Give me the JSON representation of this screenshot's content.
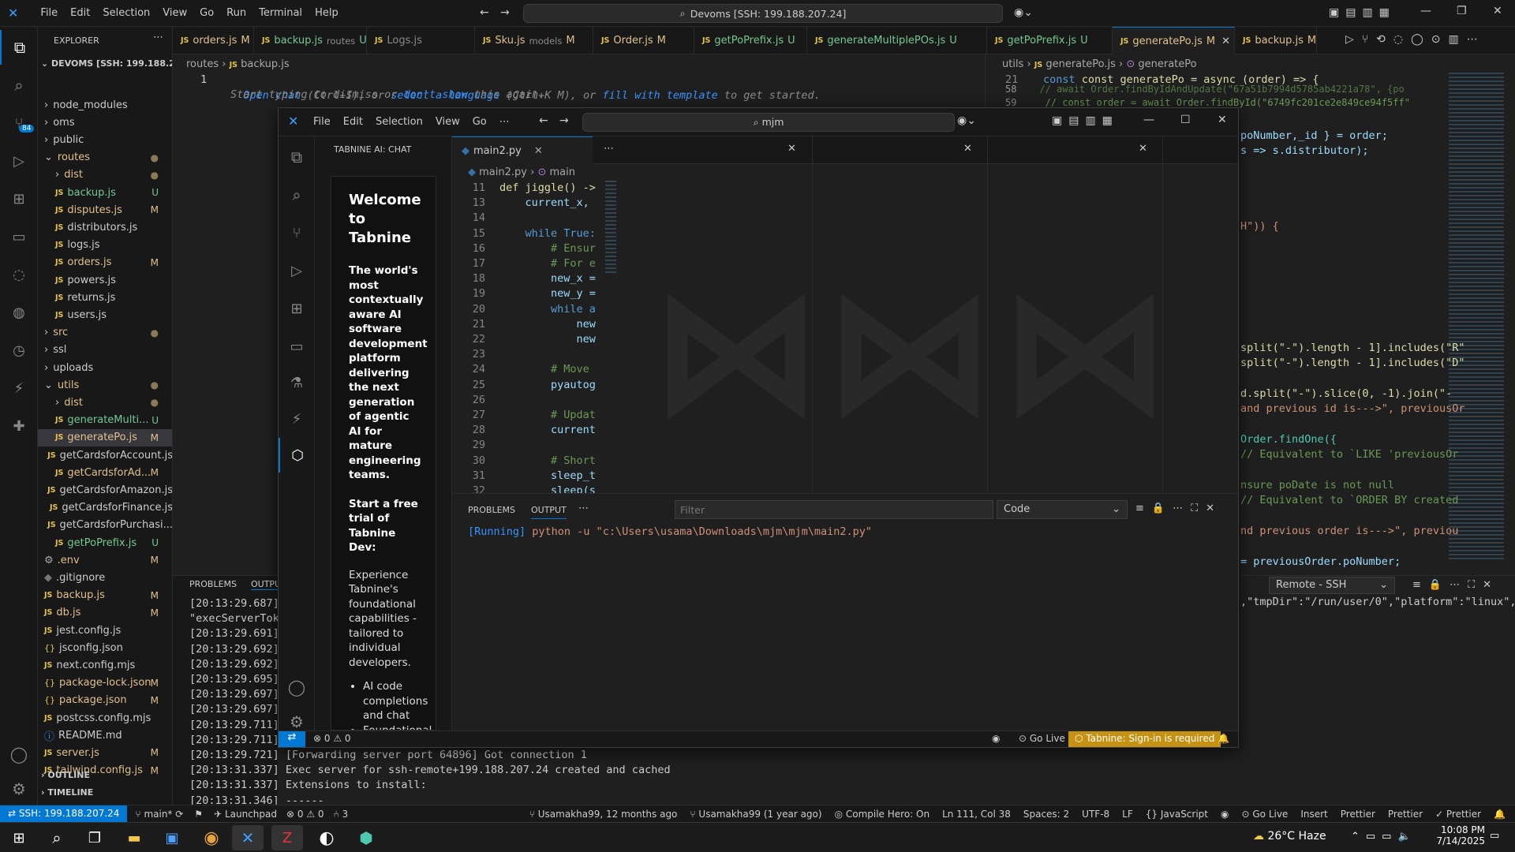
{
  "menu": [
    "File",
    "Edit",
    "Selection",
    "View",
    "Go",
    "Run",
    "Terminal",
    "Help"
  ],
  "command_center": "Devoms [SSH: 199.188.207.24]",
  "explorer": {
    "title": "EXPLORER",
    "root": "DEVOMS [SSH: 199.188.20...",
    "items": [
      {
        "label": "node_modules",
        "type": "folder",
        "badge": "",
        "indent": 1
      },
      {
        "label": "oms",
        "type": "folder",
        "badge": "",
        "indent": 1
      },
      {
        "label": "public",
        "type": "folder",
        "badge": "",
        "indent": 1
      },
      {
        "label": "routes",
        "type": "folder-open",
        "badge": "●",
        "indent": 1
      },
      {
        "label": "dist",
        "type": "folder",
        "badge": "●",
        "indent": 2
      },
      {
        "label": "backup.js",
        "type": "js",
        "badge": "U",
        "indent": 2
      },
      {
        "label": "disputes.js",
        "type": "js",
        "badge": "M",
        "indent": 2
      },
      {
        "label": "distributors.js",
        "type": "js",
        "badge": "",
        "indent": 2
      },
      {
        "label": "logs.js",
        "type": "js",
        "badge": "",
        "indent": 2
      },
      {
        "label": "orders.js",
        "type": "js",
        "badge": "M",
        "indent": 2
      },
      {
        "label": "powers.js",
        "type": "js",
        "badge": "",
        "indent": 2
      },
      {
        "label": "returns.js",
        "type": "js",
        "badge": "",
        "indent": 2
      },
      {
        "label": "users.js",
        "type": "js",
        "badge": "",
        "indent": 2
      },
      {
        "label": "src",
        "type": "folder",
        "badge": "●",
        "indent": 1
      },
      {
        "label": "ssl",
        "type": "folder",
        "badge": "",
        "indent": 1
      },
      {
        "label": "uploads",
        "type": "folder",
        "badge": "",
        "indent": 1
      },
      {
        "label": "utils",
        "type": "folder-open",
        "badge": "●",
        "indent": 1
      },
      {
        "label": "dist",
        "type": "folder",
        "badge": "●",
        "indent": 2
      },
      {
        "label": "generateMulti...",
        "type": "js",
        "badge": "U",
        "indent": 2
      },
      {
        "label": "generatePo.js",
        "type": "js",
        "badge": "M",
        "indent": 2,
        "selected": true
      },
      {
        "label": "getCardsforAccount.js",
        "type": "js",
        "badge": "",
        "indent": 2
      },
      {
        "label": "getCardsforAd...",
        "type": "js",
        "badge": "M",
        "indent": 2
      },
      {
        "label": "getCardsforAmazon.js",
        "type": "js",
        "badge": "",
        "indent": 2
      },
      {
        "label": "getCardsforFinance.js",
        "type": "js",
        "badge": "",
        "indent": 2
      },
      {
        "label": "getCardsforPurchasi...",
        "type": "js",
        "badge": "",
        "indent": 2
      },
      {
        "label": "getPoPrefix.js",
        "type": "js",
        "badge": "U",
        "indent": 2
      },
      {
        "label": ".env",
        "type": "gear",
        "badge": "M",
        "indent": 1
      },
      {
        "label": ".gitignore",
        "type": "git",
        "badge": "",
        "indent": 1
      },
      {
        "label": "backup.js",
        "type": "js",
        "badge": "M",
        "indent": 1
      },
      {
        "label": "db.js",
        "type": "js",
        "badge": "M",
        "indent": 1
      },
      {
        "label": "jest.config.js",
        "type": "js",
        "badge": "",
        "indent": 1
      },
      {
        "label": "jsconfig.json",
        "type": "json",
        "badge": "",
        "indent": 1
      },
      {
        "label": "next.config.mjs",
        "type": "js",
        "badge": "",
        "indent": 1
      },
      {
        "label": "package-lock.json",
        "type": "json",
        "badge": "M",
        "indent": 1
      },
      {
        "label": "package.json",
        "type": "json",
        "badge": "M",
        "indent": 1
      },
      {
        "label": "postcss.config.mjs",
        "type": "js",
        "badge": "",
        "indent": 1
      },
      {
        "label": "README.md",
        "type": "info",
        "badge": "",
        "indent": 1
      },
      {
        "label": "server.js",
        "type": "js",
        "badge": "M",
        "indent": 1
      },
      {
        "label": "tailwind.config.js",
        "type": "js",
        "badge": "M",
        "indent": 1
      }
    ],
    "outline": "OUTLINE",
    "timeline": "TIMELINE"
  },
  "tabs": [
    {
      "label": "orders.js",
      "badge": "M"
    },
    {
      "label": "backup.js",
      "sub": "routes",
      "badge": "U"
    },
    {
      "label": "Logs.js",
      "badge": ""
    },
    {
      "label": "Sku.js",
      "sub": "models",
      "badge": "M"
    },
    {
      "label": "Order.js",
      "badge": "M"
    },
    {
      "label": "getPoPrefix.js",
      "badge": "U"
    },
    {
      "label": "generateMultiplePOs.js",
      "badge": "U"
    },
    {
      "label": "getPoPrefix.js",
      "badge": "U"
    },
    {
      "label": "generatePo.js",
      "badge": "M",
      "active": true
    },
    {
      "label": "backup.js",
      "badge": "M"
    }
  ],
  "left_editor": {
    "breadcrumb": [
      "routes",
      "backup.js"
    ],
    "line_no": "1",
    "hint_line1": [
      "Open chat",
      " (Ctrl+I), or ",
      "select a language",
      " (Ctrl+K M), or ",
      "fill with template",
      " to get started."
    ],
    "hint_line2": [
      "Start typing to dismiss or ",
      "don't show",
      " this again."
    ]
  },
  "right_editor": {
    "breadcrumb": [
      "utils",
      "generatePo.js",
      "generatePo"
    ],
    "line_numbers": [
      "21",
      "58",
      "59"
    ],
    "line21": "const generatePo = async (order) => {",
    "fragments": [
      "// await Order.findByIdAndUpdate(\"67a51b7994d5785ab4221a78\", {po",
      "// const order = await Order.findById(\"6749fc201ce2e849ce94f5ff\"",
      "poNumber,_id } = order;",
      "s => s.distributor);",
      "H\")) {",
      "split(\"-\").length - 1].includes(\"R\"",
      "split(\"-\").length - 1].includes(\"D\"",
      "d.split(\"-\").slice(0, -1).join(\"-",
      "and previous id is--->\", previousOr",
      "Order.findOne({",
      "// Equivalent to `LIKE 'previousOr",
      "nsure poDate is not null",
      "// Equivalent to `ORDER BY created",
      "nd previous order is--->\", previou",
      "= previousOrder.poNumber;"
    ],
    "panel_dropdown": "Remote - SSH",
    "panel_text": ",\"tmpDir\":\"/run/user/0\",\"platform\":\"linux\","
  },
  "bottom_panel": {
    "tabs": [
      "PROBLEMS",
      "OUTPUT"
    ],
    "lines": [
      "[20:13:29.687]",
      "\"execServerToke",
      "[20:13:29.691]",
      "[20:13:29.692]",
      "[20:13:29.692]",
      "[20:13:29.695]",
      "[20:13:29.697]",
      "[20:13:29.697]",
      "[20:13:29.711]",
      "[20:13:29.711]",
      "[20:13:29.721] [Forwarding server port 64896] Got connection 1",
      "[20:13:31.337] Exec server for ssh-remote+199.188.207.24 created and cached",
      "[20:13:31.337] Extensions to install:",
      "[20:13:31.346] ------"
    ]
  },
  "front": {
    "menu": [
      "File",
      "Edit",
      "Selection",
      "View",
      "Go"
    ],
    "command_center": "mjm",
    "chat_title": "TABNINE AI: CHAT",
    "welcome_title": "Welcome to Tabnine",
    "welcome_desc": "The world's most contextually aware AI software development platform delivering the next generation of agentic AI for mature engineering teams.",
    "trial_title": "Start a free trial of Tabnine Dev:",
    "trial_desc": "Experience Tabnine's foundational capabilities - tailored to individual developers.",
    "bullets": [
      "AI code completions and chat",
      "Foundational"
    ],
    "editor_tab": "main2.py",
    "breadcrumb": [
      "main2.py",
      "main"
    ],
    "code_lines": [
      {
        "n": "11",
        "t": "def jiggle() ->"
      },
      {
        "n": "13",
        "t": "    current_x,"
      },
      {
        "n": "14",
        "t": ""
      },
      {
        "n": "15",
        "t": "    while True:"
      },
      {
        "n": "16",
        "t": "        # Ensur"
      },
      {
        "n": "17",
        "t": "        # For e"
      },
      {
        "n": "18",
        "t": "        new_x ="
      },
      {
        "n": "19",
        "t": "        new_y ="
      },
      {
        "n": "20",
        "t": "        while a"
      },
      {
        "n": "21",
        "t": "            new"
      },
      {
        "n": "22",
        "t": "            new"
      },
      {
        "n": "23",
        "t": ""
      },
      {
        "n": "24",
        "t": "        # Move"
      },
      {
        "n": "25",
        "t": "        pyautog"
      },
      {
        "n": "26",
        "t": ""
      },
      {
        "n": "27",
        "t": "        # Updat"
      },
      {
        "n": "28",
        "t": "        current"
      },
      {
        "n": "29",
        "t": ""
      },
      {
        "n": "30",
        "t": "        # Short"
      },
      {
        "n": "31",
        "t": "        sleep_t"
      },
      {
        "n": "32",
        "t": "        sleep(s"
      }
    ],
    "panel_tabs": [
      "PROBLEMS",
      "OUTPUT"
    ],
    "filter_placeholder": "Filter",
    "output_dropdown": "Code",
    "output_running": "[Running]",
    "output_cmd": " python -u \"c:\\Users\\usama\\Downloads\\mjm\\mjm\\main2.py\"",
    "status": {
      "errors": "0",
      "warnings": "0",
      "golive": "Go Live",
      "tabnine": "Tabnine: Sign-in is required"
    }
  },
  "statusbar": {
    "remote": "SSH: 199.188.207.24",
    "branch": "main*",
    "launchpad": "Launchpad",
    "errors": "0",
    "warnings": "0",
    "ports": "3",
    "blame1": "Usamakha99, 12 months ago",
    "blame2": "Usamakha99 (1 year ago)",
    "compile": "Compile Hero: On",
    "position": "Ln 111, Col 38",
    "spaces": "Spaces: 2",
    "encoding": "UTF-8",
    "eol": "LF",
    "language": "JavaScript",
    "golive": "Go Live",
    "insert": "Insert",
    "prettier1": "Prettier",
    "prettier2": "Prettier",
    "prettier3": "Prettier"
  },
  "taskbar": {
    "weather": "26°C",
    "weather_desc": "Haze",
    "time": "10:08 PM",
    "date": "7/14/2025"
  },
  "colors": {
    "accent": "#0078d4",
    "modified": "#e2c08d",
    "untracked": "#73c991",
    "remote": "#0078d4"
  }
}
